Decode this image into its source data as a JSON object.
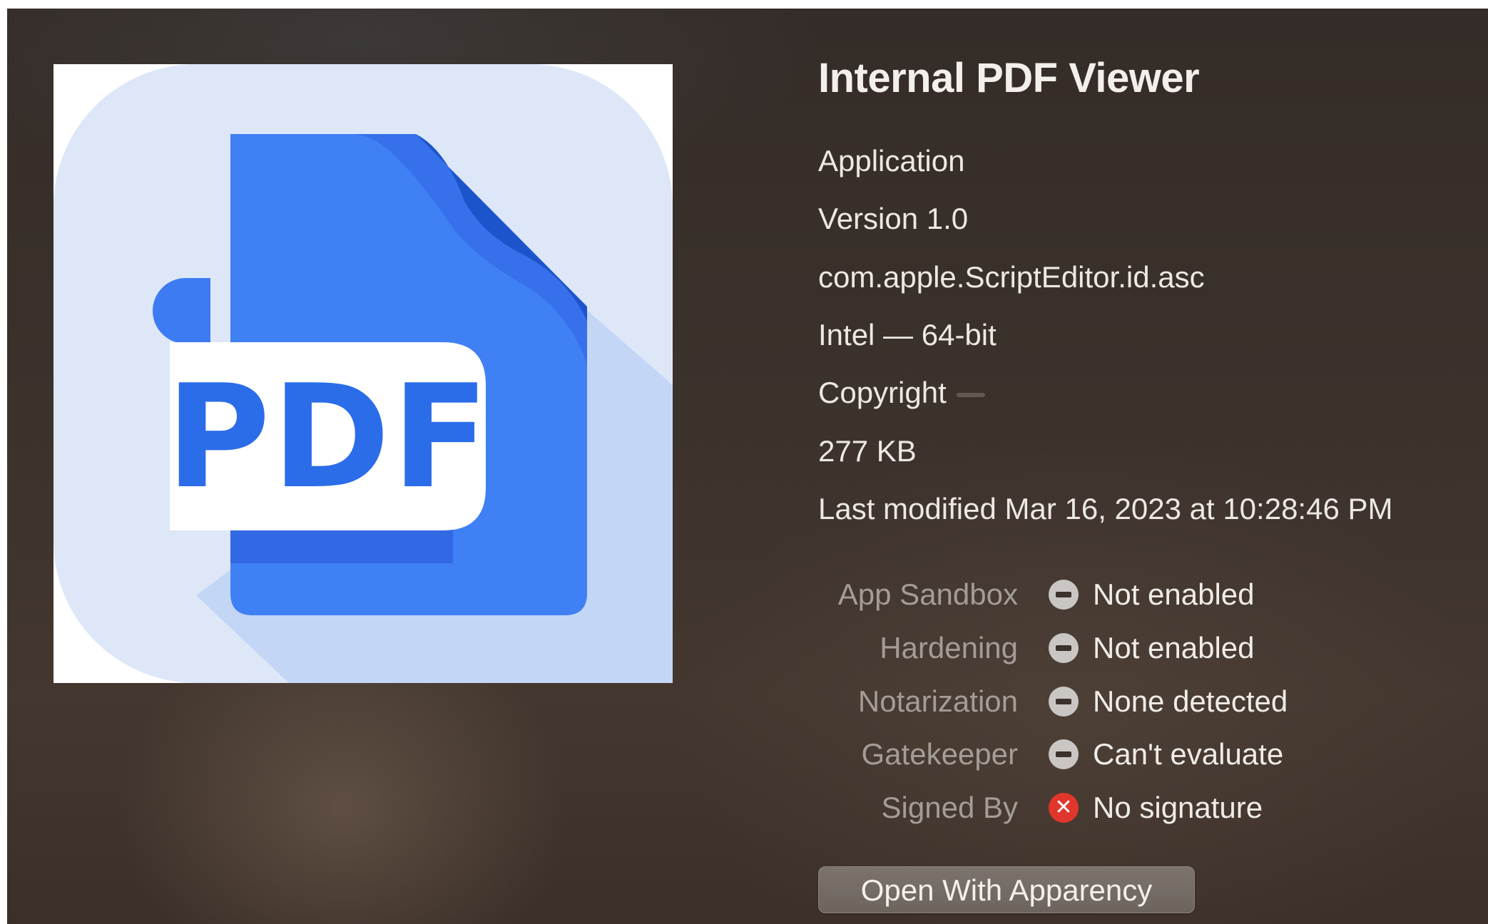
{
  "app": {
    "name": "Internal PDF Viewer",
    "icon": "pdf-document-icon",
    "icon_text": "PDF",
    "kind": "Application",
    "version": "Version 1.0",
    "bundle_id": "com.apple.ScriptEditor.id.asc",
    "architecture": "Intel — 64-bit",
    "copyright": "Copyright",
    "size": "277 KB",
    "last_modified": "Last modified Mar 16, 2023 at 10:28:46 PM"
  },
  "security": [
    {
      "label": "App Sandbox",
      "value": "Not enabled",
      "status": "neutral",
      "icon": "minus-circle-icon"
    },
    {
      "label": "Hardening",
      "value": "Not enabled",
      "status": "neutral",
      "icon": "minus-circle-icon"
    },
    {
      "label": "Notarization",
      "value": "None detected",
      "status": "neutral",
      "icon": "minus-circle-icon"
    },
    {
      "label": "Gatekeeper",
      "value": "Can't evaluate",
      "status": "neutral",
      "icon": "minus-circle-icon"
    },
    {
      "label": "Signed By",
      "value": "No signature",
      "status": "bad",
      "icon": "x-circle-icon"
    }
  ],
  "actions": {
    "open_with_label": "Open With Apparency"
  },
  "colors": {
    "icon_background": "#dde7f8",
    "icon_blue": "#4080f5",
    "icon_dark_blue": "#1c54cc",
    "error_red": "#e0362c"
  }
}
